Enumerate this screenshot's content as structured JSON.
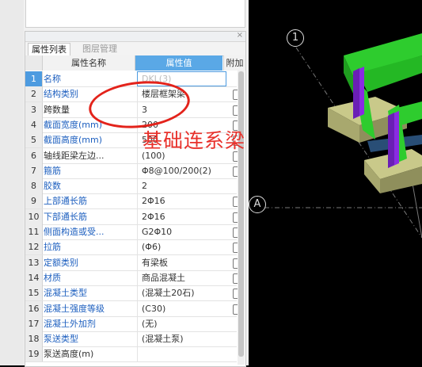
{
  "panel": {
    "close_icon": "close-icon",
    "tabs": [
      {
        "label": "属性列表",
        "active": true
      },
      {
        "label": "图层管理",
        "active": false
      }
    ],
    "columns": {
      "num": "",
      "name": "属性名称",
      "value": "属性值",
      "extra": "附加"
    }
  },
  "rows": [
    {
      "num": "1",
      "name": "名称",
      "value": "DKL(3)",
      "selected": true,
      "checkbox": false,
      "name_color": "blue"
    },
    {
      "num": "2",
      "name": "结构类别",
      "value": "楼层框架梁",
      "checkbox": true,
      "name_color": "blue"
    },
    {
      "num": "3",
      "name": "跨数量",
      "value": "3",
      "checkbox": true,
      "name_color": "plain"
    },
    {
      "num": "4",
      "name": "截面宽度(mm)",
      "value": "200",
      "checkbox": true,
      "name_color": "blue"
    },
    {
      "num": "5",
      "name": "截面高度(mm)",
      "value": "500",
      "checkbox": true,
      "name_color": "blue"
    },
    {
      "num": "6",
      "name": "轴线距梁左边...",
      "value": "(100)",
      "checkbox": true,
      "name_color": "plain"
    },
    {
      "num": "7",
      "name": "箍筋",
      "value": "Φ8@100/200(2)",
      "checkbox": true,
      "name_color": "blue"
    },
    {
      "num": "8",
      "name": "胶数",
      "value": "2",
      "checkbox": false,
      "name_color": "blue"
    },
    {
      "num": "9",
      "name": "上部通长筋",
      "value": "2Φ16",
      "checkbox": true,
      "name_color": "blue"
    },
    {
      "num": "10",
      "name": "下部通长筋",
      "value": "2Φ16",
      "checkbox": true,
      "name_color": "blue"
    },
    {
      "num": "11",
      "name": "侧面构造或受...",
      "value": "G2Φ10",
      "checkbox": true,
      "name_color": "blue"
    },
    {
      "num": "12",
      "name": "拉筋",
      "value": "(Φ6)",
      "checkbox": true,
      "name_color": "blue"
    },
    {
      "num": "13",
      "name": "定额类别",
      "value": "有梁板",
      "checkbox": true,
      "name_color": "blue"
    },
    {
      "num": "14",
      "name": "材质",
      "value": "商品混凝土",
      "checkbox": true,
      "name_color": "blue"
    },
    {
      "num": "15",
      "name": "混凝土类型",
      "value": "(混凝土20石)",
      "checkbox": true,
      "name_color": "blue"
    },
    {
      "num": "16",
      "name": "混凝土强度等级",
      "value": "(C30)",
      "checkbox": true,
      "name_color": "blue"
    },
    {
      "num": "17",
      "name": "混凝土外加剂",
      "value": "(无)",
      "checkbox": false,
      "name_color": "blue"
    },
    {
      "num": "18",
      "name": "泵送类型",
      "value": "(混凝土泵)",
      "checkbox": false,
      "name_color": "blue"
    },
    {
      "num": "19",
      "name": "泵送高度(m)",
      "value": "",
      "checkbox": false,
      "name_color": "plain"
    }
  ],
  "annotation": {
    "text": "基础连系梁"
  },
  "view": {
    "axis_labels": [
      "1",
      "A"
    ],
    "colors": {
      "beam": "#2ecc2e",
      "column": "#8a2be2",
      "footing": "#c9c98a",
      "annotation": "#e3231b",
      "selected": "#4d9be0"
    }
  }
}
